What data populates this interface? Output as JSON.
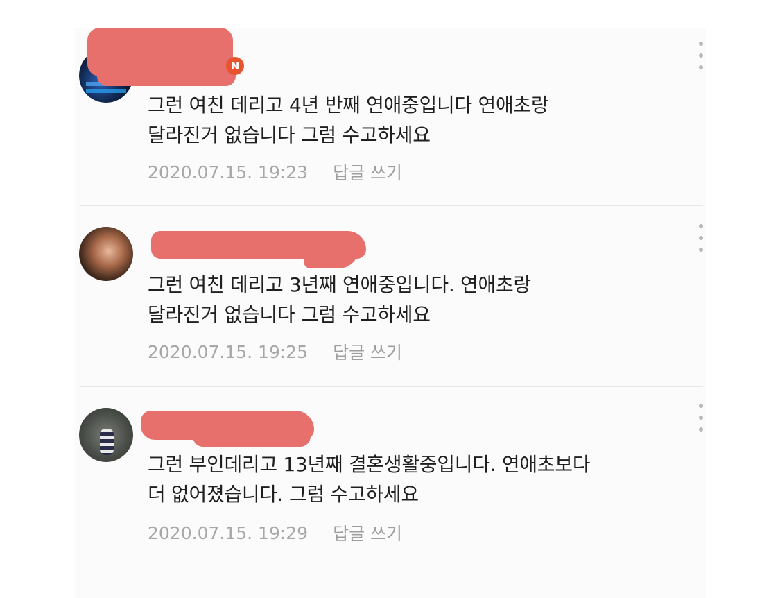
{
  "comments": [
    {
      "badge": "N",
      "text": "그런 여친 데리고 4년 반째 연애중입니다 연애초랑\n달라진거 없습니다 그럼 수고하세요",
      "timestamp": "2020.07.15. 19:23",
      "reply_label": "답글 쓰기",
      "avatar_icon": "avatar-icon"
    },
    {
      "badge": "",
      "text": "그런 여친 데리고 3년째 연애중입니다. 연애초랑\n달라진거 없습니다 그럼 수고하세요",
      "timestamp": "2020.07.15. 19:25",
      "reply_label": "답글 쓰기",
      "avatar_icon": "avatar-icon"
    },
    {
      "badge": "",
      "text": "그런 부인데리고 13년째 결혼생활중입니다. 연애초보다\n더 없어졌습니다. 그럼 수고하세요",
      "timestamp": "2020.07.15. 19:29",
      "reply_label": "답글 쓰기",
      "avatar_icon": "avatar-icon"
    }
  ],
  "colors": {
    "redaction": "#e8706c",
    "badge": "#e8542d",
    "meta_text": "#a7a7a7"
  }
}
